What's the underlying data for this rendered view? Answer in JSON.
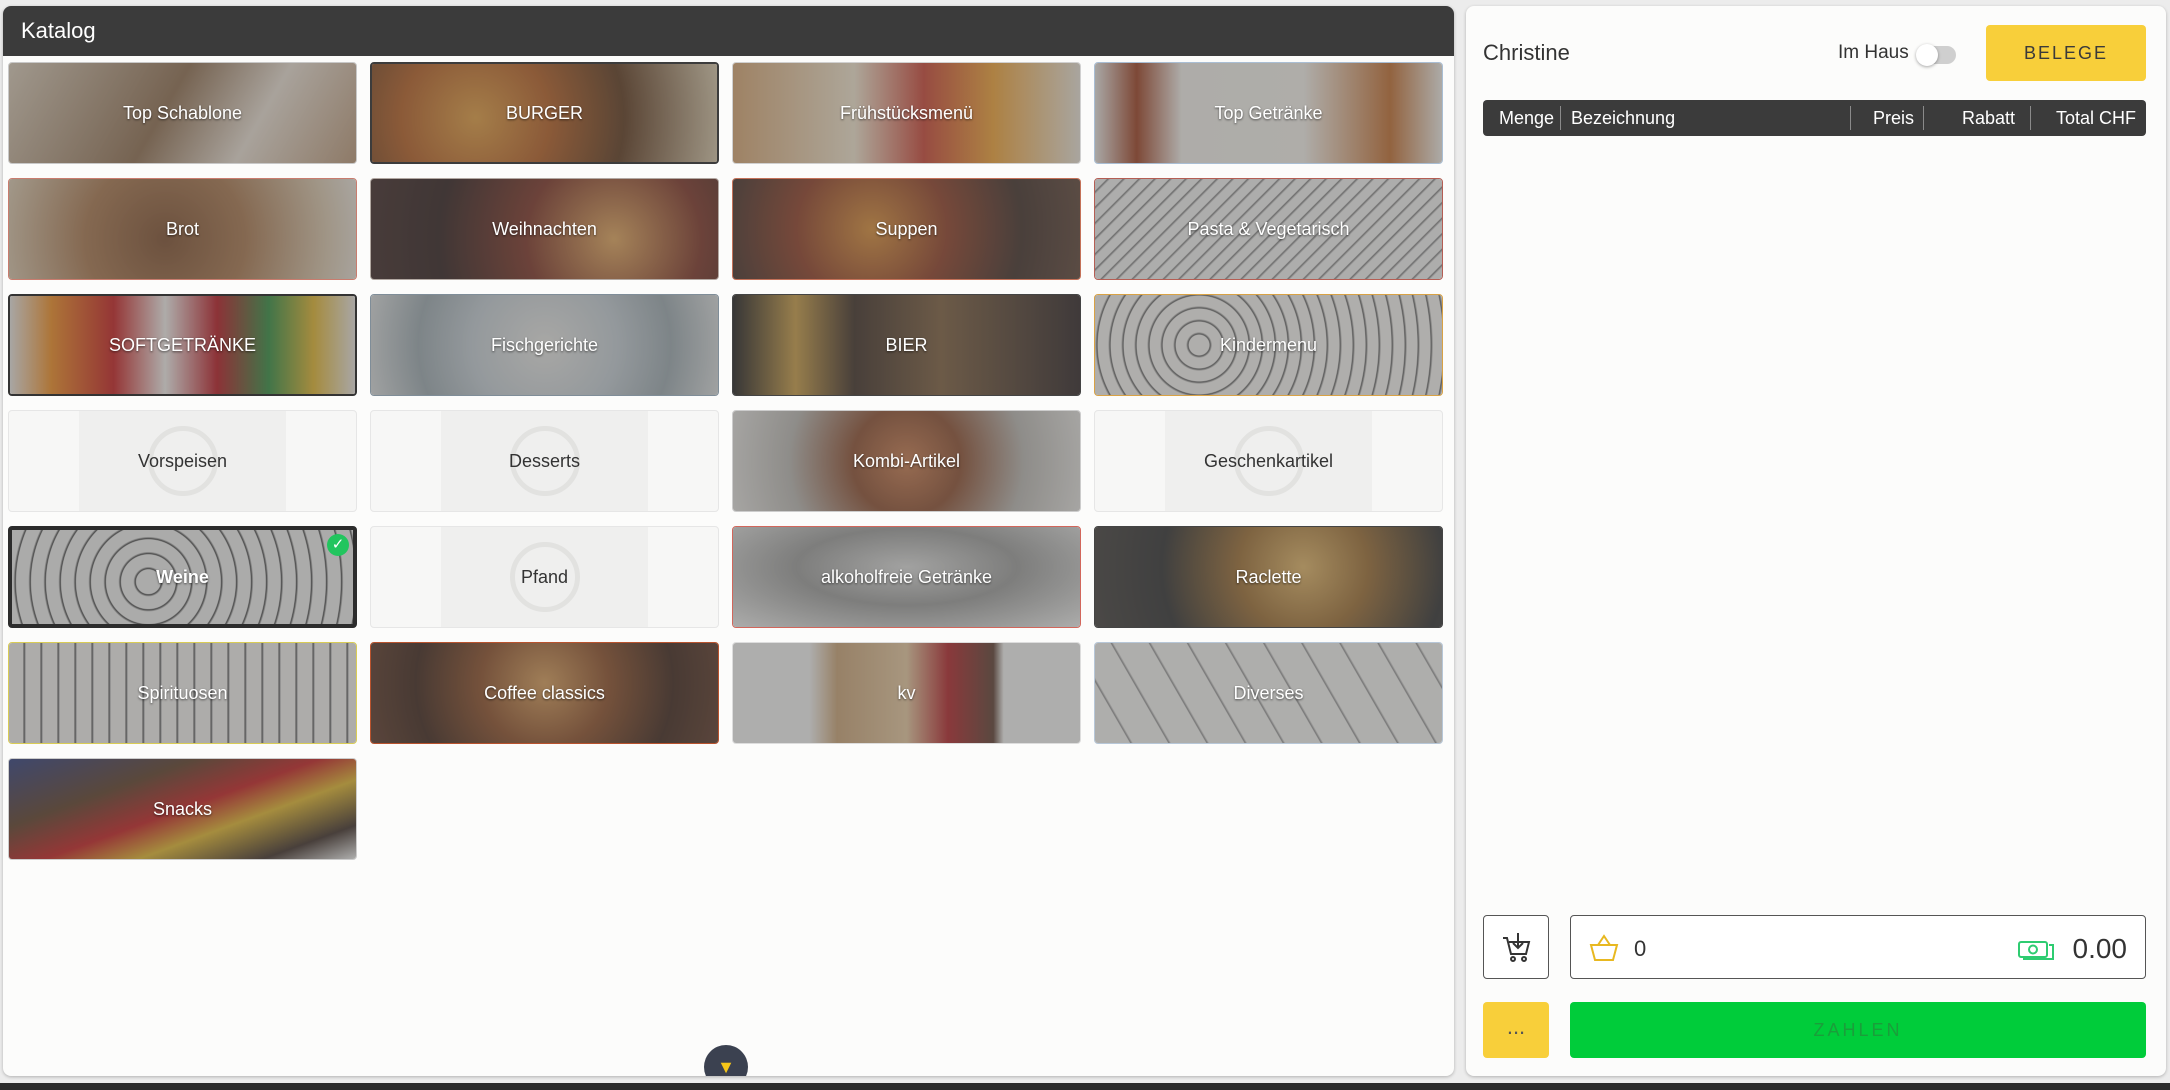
{
  "catalog": {
    "title": "Katalog",
    "tiles": [
      {
        "label": "Top Schablone"
      },
      {
        "label": "BURGER"
      },
      {
        "label": "Frühstücksmenü"
      },
      {
        "label": "Top Getränke"
      },
      {
        "label": "Brot"
      },
      {
        "label": "Weihnachten"
      },
      {
        "label": "Suppen"
      },
      {
        "label": "Pasta & Vegetarisch"
      },
      {
        "label": "SOFTGETRÄNKE"
      },
      {
        "label": "Fischgerichte"
      },
      {
        "label": "BIER"
      },
      {
        "label": "Kindermenu"
      },
      {
        "label": "Vorspeisen"
      },
      {
        "label": "Desserts"
      },
      {
        "label": "Kombi-Artikel"
      },
      {
        "label": "Geschenkartikel"
      },
      {
        "label": "Weine",
        "selected": true
      },
      {
        "label": "Pfand"
      },
      {
        "label": "alkoholfreie Getränke"
      },
      {
        "label": "Raclette"
      },
      {
        "label": "Spirituosen"
      },
      {
        "label": "Coffee classics"
      },
      {
        "label": "kv"
      },
      {
        "label": "Diverses"
      },
      {
        "label": "Snacks"
      }
    ],
    "scroll_icon": "chevron-down-icon",
    "check_mark": "✓"
  },
  "order": {
    "customer_name": "Christine",
    "in_house_label": "Im Haus",
    "in_house_on": false,
    "receipts_label": "BELEGE",
    "columns": [
      "Menge",
      "Bezeichnung",
      "Preis",
      "Rabatt",
      "Total CHF"
    ],
    "item_count": "0",
    "total_amount": "0.00",
    "more_label": "...",
    "pay_label": "ZAHLEN"
  },
  "colors": {
    "accent_yellow": "#f8cf3a",
    "pay_green": "#00cc3a",
    "header_dark": "#3b3b3b",
    "selected_check": "#22c55e"
  }
}
